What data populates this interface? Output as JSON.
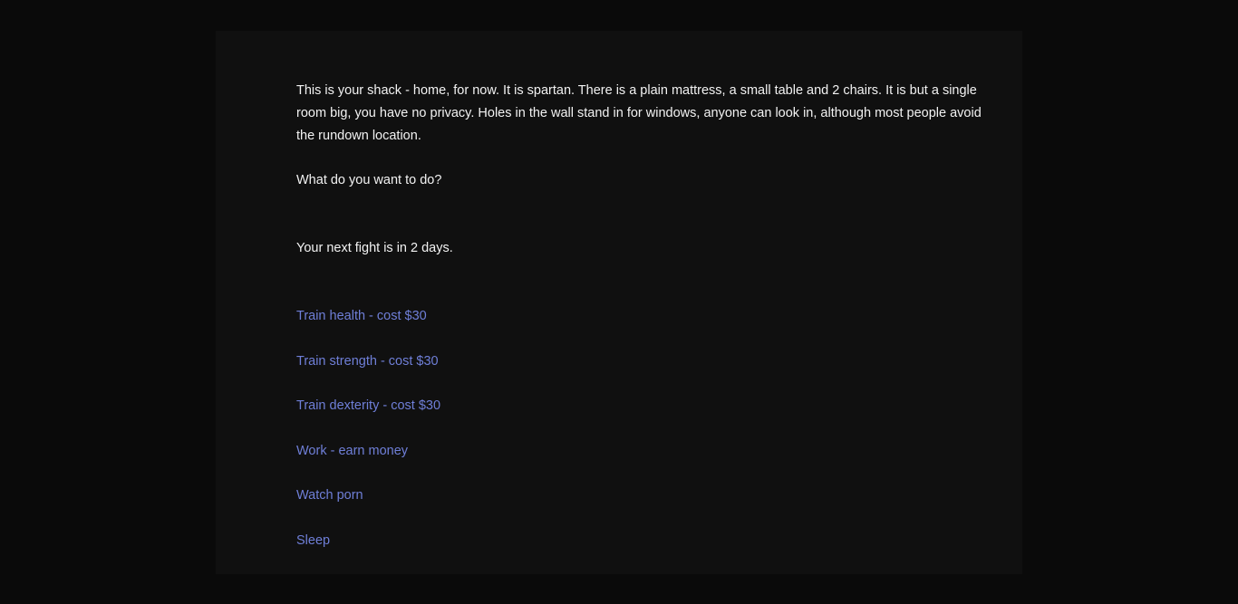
{
  "passage": {
    "description": "This is your shack - home, for now. It is spartan. There is a plain mattress, a small table and 2 chairs. It is but a single room big, you have no privacy. Holes in the wall stand in for windows, anyone can look in, although most people avoid the rundown location.",
    "question": "What do you want to do?",
    "fight_notice": "Your next fight is in 2 days."
  },
  "choices": [
    {
      "label": "Train health - cost $30"
    },
    {
      "label": "Train strength - cost $30"
    },
    {
      "label": "Train dexterity - cost $30"
    },
    {
      "label": "Work - earn money"
    },
    {
      "label": "Watch porn"
    },
    {
      "label": "Sleep"
    }
  ],
  "colors": {
    "background": "#0a0a0a",
    "panel": "#101010",
    "text": "#f2f2f2",
    "link": "#6f7fd8"
  }
}
